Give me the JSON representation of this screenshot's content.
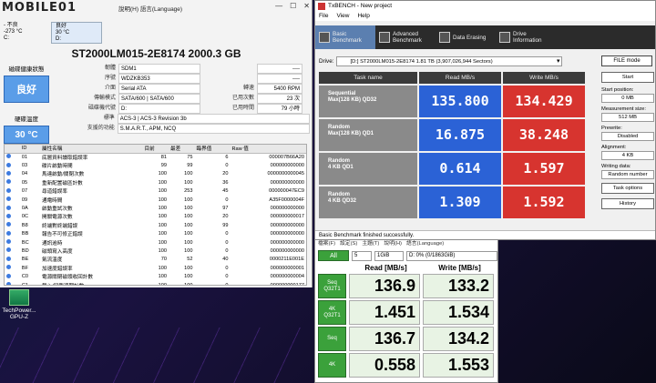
{
  "cdi": {
    "logo": "MOBILE01",
    "menu": "說明(H)  語言(Language)",
    "drives": [
      {
        "status": "- 不良",
        "temp": "-273 °C",
        "letter": "C:"
      },
      {
        "status": "良好",
        "temp": "30 °C",
        "letter": "D:"
      }
    ],
    "title": "ST2000LM015-2E8174 2000.3 GB",
    "health_label": "磁碟健康狀態",
    "health_value": "良好",
    "temp_label": "硬碟溫度",
    "temp_value": "30 °C",
    "info": [
      {
        "k": "韌體",
        "v": "SDM1",
        "k2": "",
        "v2": "----"
      },
      {
        "k": "序號",
        "v": "WDZKB353",
        "k2": "",
        "v2": "----"
      },
      {
        "k": "介面",
        "v": "Serial ATA",
        "k2": "轉速",
        "v2": "5400 RPM"
      },
      {
        "k": "傳輸模式",
        "v": "SATA/600 | SATA/600",
        "k2": "已用次數",
        "v2": "23 次"
      },
      {
        "k": "磁碟機代號",
        "v": "D:",
        "k2": "已用時間",
        "v2": "79 小時"
      }
    ],
    "standard_label": "標準",
    "standard_value": "ACS-3 | ACS-3 Revision 3b",
    "features_label": "支援的功能",
    "features_value": "S.M.A.R.T., APM, NCQ",
    "smart_headers": [
      "ID",
      "屬性名稱",
      "目前",
      "最差",
      "臨界值",
      "Raw 值"
    ],
    "smart_rows": [
      [
        "01",
        "底層資料讀取錯誤率",
        "81",
        "75",
        "6",
        "000007B66A20"
      ],
      [
        "03",
        "碟片啟動時間",
        "99",
        "99",
        "0",
        "000000000000"
      ],
      [
        "04",
        "馬達啟動/關閉次數",
        "100",
        "100",
        "20",
        "0000000000045"
      ],
      [
        "05",
        "重新配置磁區計數",
        "100",
        "100",
        "36",
        "000000000000"
      ],
      [
        "07",
        "尋道錯誤率",
        "100",
        "253",
        "45",
        "000000047EC9"
      ],
      [
        "09",
        "通電時間",
        "100",
        "100",
        "0",
        "A35F0000004F"
      ],
      [
        "0A",
        "啟動重試次數",
        "100",
        "100",
        "97",
        "000000000000"
      ],
      [
        "0C",
        "開關電源次數",
        "100",
        "100",
        "20",
        "000000000017"
      ],
      [
        "B8",
        "終端對終端錯誤",
        "100",
        "100",
        "99",
        "000000000000"
      ],
      [
        "BB",
        "報告不可修正錯誤",
        "100",
        "100",
        "0",
        "000000000000"
      ],
      [
        "BC",
        "通訊逾時",
        "100",
        "100",
        "0",
        "000000000000"
      ],
      [
        "BD",
        "磁頭寫入高度",
        "100",
        "100",
        "0",
        "000000000000"
      ],
      [
        "BE",
        "氣流溫度",
        "70",
        "52",
        "40",
        "0000211E001E"
      ],
      [
        "BF",
        "加速度錯誤率",
        "100",
        "100",
        "0",
        "000000000001"
      ],
      [
        "C0",
        "電源關閉磁頭收回計數",
        "100",
        "100",
        "0",
        "000000000004"
      ],
      [
        "C1",
        "載入/卸載週期計數",
        "100",
        "100",
        "0",
        "000000000177"
      ]
    ]
  },
  "desktop": {
    "icon_label": "TechPower... GPU-Z"
  },
  "tx": {
    "title": "TxBENCH - New project",
    "menu": [
      "File",
      "View",
      "Help"
    ],
    "tabs": [
      "Basic Benchmark",
      "Advanced Benchmark",
      "Data Erasing",
      "Drive Information"
    ],
    "drive_label": "Drive:",
    "drive_value": "[D:] ST2000LM015-2E8174  1.81 TB (3,907,026,944 Sectors)",
    "file_mode": "FILE mode",
    "headers": [
      "Task name",
      "Read MB/s",
      "Write MB/s"
    ],
    "rows": [
      {
        "name1": "Sequential",
        "name2": "Max(128 KB) QD32",
        "read": "135.800",
        "write": "134.429"
      },
      {
        "name1": "Random",
        "name2": "Max(128 KB) QD1",
        "read": "16.875",
        "write": "38.248"
      },
      {
        "name1": "Random",
        "name2": "4 KB QD1",
        "read": "0.614",
        "write": "1.597"
      },
      {
        "name1": "Random",
        "name2": "4 KB QD32",
        "read": "1.309",
        "write": "1.592"
      }
    ],
    "start": "Start",
    "start_pos_label": "Start position:",
    "start_pos": "0 MB",
    "measure_label": "Measurement size:",
    "measure": "512 MB",
    "prewrite_label": "Prewrite:",
    "prewrite": "Disabled",
    "align_label": "Alignment:",
    "align": "4 KB",
    "writing_label": "Writing data:",
    "writing": "Random number",
    "task_options": "Task options",
    "history": "History",
    "status": "Basic Benchmark finished successfully."
  },
  "cdm": {
    "menu": [
      "檔案(F)",
      "設定(S)",
      "主題(T)",
      "說明(H)",
      "語言(Language)"
    ],
    "all": "All",
    "count": "5",
    "size": "1GiB",
    "drive": "D: 0% (0/1863GiB)",
    "read_hdr": "Read [MB/s]",
    "write_hdr": "Write [MB/s]",
    "rows": [
      {
        "t1": "Seq",
        "t2": "Q32T1",
        "read": "136.9",
        "write": "133.2"
      },
      {
        "t1": "4K",
        "t2": "Q32T1",
        "read": "1.451",
        "write": "1.534"
      },
      {
        "t1": "Seq",
        "t2": "",
        "read": "136.7",
        "write": "134.2"
      },
      {
        "t1": "4K",
        "t2": "",
        "read": "0.558",
        "write": "1.553"
      }
    ]
  }
}
